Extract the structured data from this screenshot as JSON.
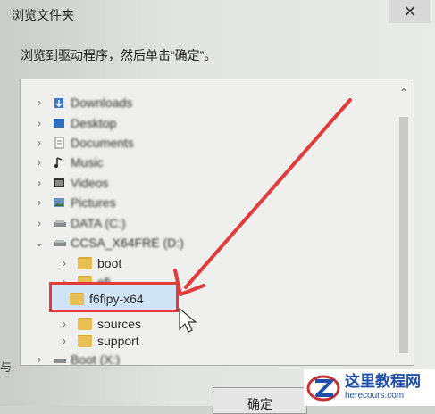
{
  "window": {
    "title": "浏览文件夹",
    "close_glyph": "✕"
  },
  "instruction": "浏览到驱动程序，然后单击“确定”。",
  "tree": {
    "items": [
      {
        "label": "Downloads",
        "icon": "download-folder-icon",
        "blurred": true,
        "expanded": false
      },
      {
        "label": "Desktop",
        "icon": "desktop-folder-icon",
        "blurred": true,
        "expanded": false
      },
      {
        "label": "Documents",
        "icon": "documents-folder-icon",
        "blurred": true,
        "expanded": false
      },
      {
        "label": "Music",
        "icon": "music-folder-icon",
        "blurred": true,
        "expanded": false
      },
      {
        "label": "Videos",
        "icon": "videos-folder-icon",
        "blurred": true,
        "expanded": false
      },
      {
        "label": "Pictures",
        "icon": "pictures-folder-icon",
        "blurred": true,
        "expanded": false
      },
      {
        "label": "DATA (C:)",
        "icon": "drive-icon",
        "blurred": true,
        "expanded": false
      },
      {
        "label": "CCSA_X64FRE (D:)",
        "icon": "drive-icon",
        "blurred": true,
        "expanded": true
      },
      {
        "label": "boot",
        "icon": "folder-icon",
        "blurred": false,
        "expanded": false
      },
      {
        "label": "efi",
        "icon": "folder-icon",
        "blurred": true,
        "expanded": false
      },
      {
        "label": "f6flpy-x64",
        "icon": "folder-icon",
        "blurred": false,
        "selected": true
      },
      {
        "label": "sources",
        "icon": "folder-icon",
        "blurred": false,
        "expanded": false
      },
      {
        "label": "support",
        "icon": "folder-icon",
        "blurred": false,
        "expanded": false
      },
      {
        "label": "Boot (X:)",
        "icon": "drive-icon",
        "blurred": true,
        "expanded": false
      }
    ]
  },
  "buttons": {
    "ok": "确定"
  },
  "left_edge_text": "与 ",
  "watermark": {
    "main": "这里教程网",
    "sub": "herecours.com"
  },
  "colors": {
    "highlight_border": "#e23b3b",
    "selection_bg": "#cfe4f5",
    "folder": "#e7bf52",
    "watermark_text": "#1f4fa8"
  }
}
